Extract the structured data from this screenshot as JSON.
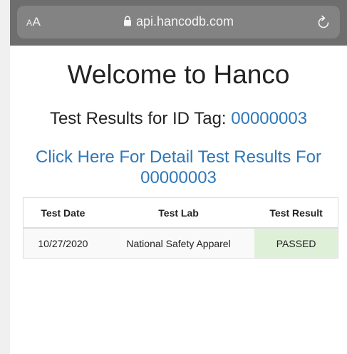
{
  "browser": {
    "aa_small": "A",
    "aa_large": "A",
    "url": "api.hancodb.com"
  },
  "page": {
    "title": "Welcome to Hanco",
    "subtitle_prefix": "Test Results for ID Tag: ",
    "id_tag": "00000003",
    "detail_link": "Click Here For Detail Test Results For 00000003"
  },
  "table": {
    "headers": [
      "Test Date",
      "Test Lab",
      "Test Result"
    ],
    "rows": [
      [
        "10/27/2020",
        "National Safety Apparel",
        "PASSED"
      ]
    ]
  },
  "colors": {
    "link": "#2f78b7",
    "passed_bg": "#dff0d8"
  }
}
